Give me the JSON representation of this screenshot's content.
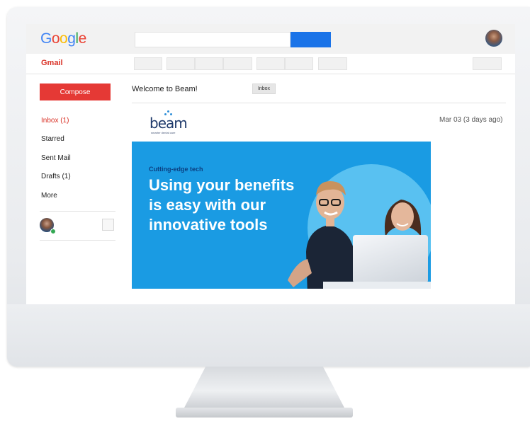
{
  "header": {
    "logo": {
      "letters": [
        "G",
        "o",
        "o",
        "g",
        "l",
        "e"
      ],
      "colors": [
        "#4285F4",
        "#EA4335",
        "#FBBC05",
        "#4285F4",
        "#34A853",
        "#EA4335"
      ]
    },
    "search": {
      "value": "",
      "placeholder": ""
    },
    "search_button_color": "#1a73e8"
  },
  "app_label": "Gmail",
  "sidebar": {
    "compose_label": "Compose",
    "items": [
      {
        "label": "Inbox (1)",
        "active": true
      },
      {
        "label": "Starred"
      },
      {
        "label": "Sent Mail"
      },
      {
        "label": "Drafts (1)"
      },
      {
        "label": "More"
      }
    ]
  },
  "message": {
    "subject": "Welcome to Beam!",
    "label_chip": "Inbox",
    "date": "Mar 03 (3 days ago)",
    "brand": {
      "name": "beam",
      "tagline": "smarter dental care"
    },
    "banner": {
      "eyebrow": "Cutting-edge tech",
      "headline_lines": [
        "Using your benefits",
        "is easy with our",
        "innovative tools"
      ],
      "background": "#1a9be3"
    }
  },
  "colors": {
    "accent_red": "#e53935",
    "active_nav": "#d93025"
  }
}
